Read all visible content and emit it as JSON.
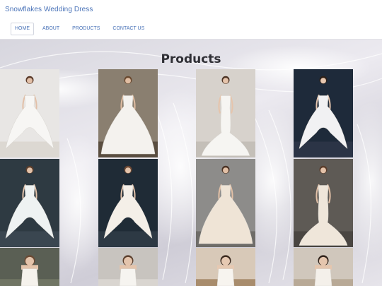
{
  "header": {
    "brand": "Snowflakes Wedding Dress",
    "nav": [
      {
        "label": "HOME",
        "active": true
      },
      {
        "label": "ABOUT",
        "active": false
      },
      {
        "label": "PRODUCTS",
        "active": false
      },
      {
        "label": "CONTACT US",
        "active": false
      }
    ]
  },
  "main": {
    "title": "Products"
  },
  "colors": {
    "brand": "#4a73b8",
    "title": "#2f2f35"
  },
  "products": [
    {
      "name": "product-1",
      "bg": "#e8e6e4",
      "floor": "#dcd8d2",
      "dress": "#f7f6f4",
      "skin": "#e2c0a8",
      "hair": "#5a3a28",
      "style": "short-front"
    },
    {
      "name": "product-2",
      "bg": "#8a7f70",
      "floor": "#5a4e40",
      "dress": "#f4f2ee",
      "skin": "#e0bda2",
      "hair": "#6a4a30",
      "style": "ball"
    },
    {
      "name": "product-3",
      "bg": "#d7d2cc",
      "floor": "#c4bfb8",
      "dress": "#f6f5f2",
      "skin": "#e6c4ab",
      "hair": "#4d3424",
      "style": "mermaid"
    },
    {
      "name": "product-4",
      "bg": "#1e2a3a",
      "floor": "#2b3446",
      "dress": "#f1f1f3",
      "skin": "#e7c7b0",
      "hair": "#2d2018",
      "style": "short-front"
    },
    {
      "name": "product-5",
      "bg": "#2e3a42",
      "floor": "#3a4650",
      "dress": "#eef2f2",
      "skin": "#e2c2aa",
      "hair": "#5b3e2b",
      "style": "short-front"
    },
    {
      "name": "product-6",
      "bg": "#1f2b36",
      "floor": "#2d3944",
      "dress": "#f4efe8",
      "skin": "#e3c3ab",
      "hair": "#6c4833",
      "style": "short-front"
    },
    {
      "name": "product-7",
      "bg": "#8d8c8a",
      "floor": "#6e6c68",
      "dress": "#efe4d6",
      "skin": "#e2c0a6",
      "hair": "#4b3325",
      "style": "ball"
    },
    {
      "name": "product-8",
      "bg": "#5e5a55",
      "floor": "#4a4642",
      "dress": "#efe6da",
      "skin": "#e3c2a9",
      "hair": "#5a3d2b",
      "style": "mermaid"
    },
    {
      "name": "product-9",
      "bg": "#5a5f54",
      "floor": "#707564",
      "dress": "#f5f2ec",
      "skin": "#e3c3aa",
      "hair": "#6a4a34",
      "style": "bodice"
    },
    {
      "name": "product-10",
      "bg": "#c8c4bf",
      "floor": "#d9d5d0",
      "dress": "#f6f4f0",
      "skin": "#e4c4ac",
      "hair": "#5c402e",
      "style": "bodice-back"
    },
    {
      "name": "product-11",
      "bg": "#d8c9b8",
      "floor": "#a88c6c",
      "dress": "#f7f4ef",
      "skin": "#e6c9b2",
      "hair": "#3b2a20",
      "style": "bodice"
    },
    {
      "name": "product-12",
      "bg": "#d0c7bc",
      "floor": "#b8a996",
      "dress": "#f4f0ea",
      "skin": "#e5c6ae",
      "hair": "#2f221a",
      "style": "bodice"
    }
  ]
}
